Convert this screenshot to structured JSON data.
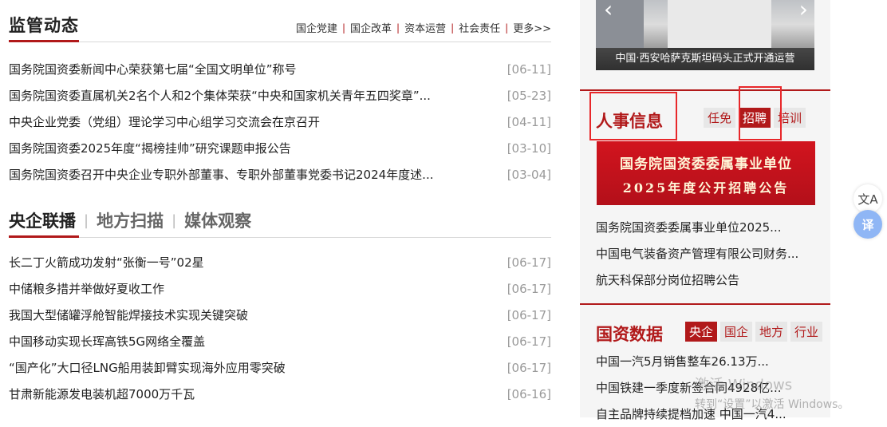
{
  "supervision": {
    "title": "监管动态",
    "links": [
      "国企党建",
      "国企改革",
      "资本运营",
      "社会责任",
      "更多>>"
    ],
    "items": [
      {
        "title": "国务院国资委新闻中心荣获第七届“全国文明单位”称号",
        "date": "[06-11]"
      },
      {
        "title": "国务院国资委直属机关2名个人和2个集体荣获“中央和国家机关青年五四奖章”...",
        "date": "[05-23]"
      },
      {
        "title": "中央企业党委（党组）理论学习中心组学习交流会在京召开",
        "date": "[04-11]"
      },
      {
        "title": "国务院国资委2025年度“揭榜挂帅”研究课题申报公告",
        "date": "[03-10]"
      },
      {
        "title": "国务院国资委召开中央企业专职外部董事、专职外部董事党委书记2024年度述...",
        "date": "[03-04]"
      }
    ]
  },
  "broadcast": {
    "tabs": [
      "央企联播",
      "地方扫描",
      "媒体观察"
    ],
    "separators": [
      "|",
      "|"
    ],
    "items": [
      {
        "title": "长二丁火箭成功发射“张衡一号”02星",
        "date": "[06-17]"
      },
      {
        "title": "中储粮多措并举做好夏收工作",
        "date": "[06-17]"
      },
      {
        "title": "我国大型储罐浮舱智能焊接技术实现关键突破",
        "date": "[06-17]"
      },
      {
        "title": "中国移动实现长珲高铁5G网络全覆盖",
        "date": "[06-17]"
      },
      {
        "title": "“国产化”大口径LNG船用装卸臂实现海外应用零突破",
        "date": "[06-17]"
      },
      {
        "title": "甘肃新能源发电装机超7000万千瓦",
        "date": "[06-16]"
      }
    ]
  },
  "carousel": {
    "caption": "中国·西安哈萨克斯坦码头正式开通运营",
    "prev_icon": "chevron-left-icon",
    "next_icon": "chevron-right-icon",
    "prev_glyph": "‹",
    "next_glyph": "›"
  },
  "personnel": {
    "title": "人事信息",
    "tabs": [
      "任免",
      "招聘",
      "培训"
    ],
    "active_tab": "招聘",
    "banner_line1": "国务院国资委委属事业单位",
    "banner_line2": "2025年度公开招聘公告",
    "items": [
      "国务院国资委委属事业单位2025...",
      "中国电气装备资产管理有限公司财务...",
      "航天科保部分岗位招聘公告"
    ]
  },
  "stats": {
    "title": "国资数据",
    "tabs": [
      "央企",
      "国企",
      "地方",
      "行业"
    ],
    "active_tab": "央企",
    "items": [
      "中国一汽5月销售整车26.13万...",
      "中国铁建一季度新签合同4928亿...",
      "自主品牌持续提档加速 中国一汽4..."
    ]
  },
  "floating": {
    "translate_icon": "translate-icon",
    "translate_glyph": "文A",
    "translate_blue_glyph": "译"
  },
  "watermark": {
    "line1": "激活 Windows",
    "line2": "转到“设置”以激活 Windows。"
  },
  "colors": {
    "accent": "#b1191a",
    "highlight_box": "#e8272a"
  }
}
